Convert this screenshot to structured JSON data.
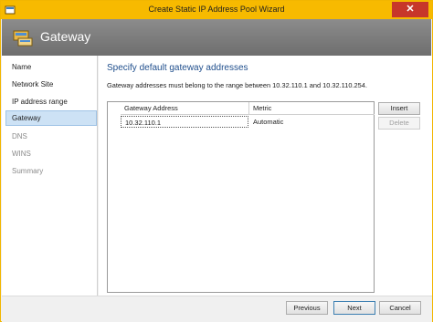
{
  "window": {
    "title": "Create Static IP Address Pool Wizard",
    "close_glyph": "✕",
    "accent_color": "#f7ba00"
  },
  "banner": {
    "title": "Gateway",
    "icon": "gateway-icon"
  },
  "nav": {
    "items": [
      {
        "label": "Name",
        "state": "normal"
      },
      {
        "label": "Network Site",
        "state": "normal"
      },
      {
        "label": "IP address range",
        "state": "normal"
      },
      {
        "label": "Gateway",
        "state": "selected"
      },
      {
        "label": "DNS",
        "state": "disabled"
      },
      {
        "label": "WINS",
        "state": "disabled"
      },
      {
        "label": "Summary",
        "state": "disabled"
      }
    ]
  },
  "main": {
    "section_title": "Specify default gateway addresses",
    "info_text": "Gateway addresses must belong to the range between 10.32.110.1 and 10.32.110.254.",
    "grid": {
      "columns": [
        "Gateway Address",
        "Metric"
      ],
      "rows": [
        {
          "address": "10.32.110.1",
          "metric": "Automatic"
        }
      ]
    },
    "insert_label": "Insert",
    "delete_label": "Delete"
  },
  "footer": {
    "previous_label": "Previous",
    "next_label": "Next",
    "cancel_label": "Cancel"
  }
}
